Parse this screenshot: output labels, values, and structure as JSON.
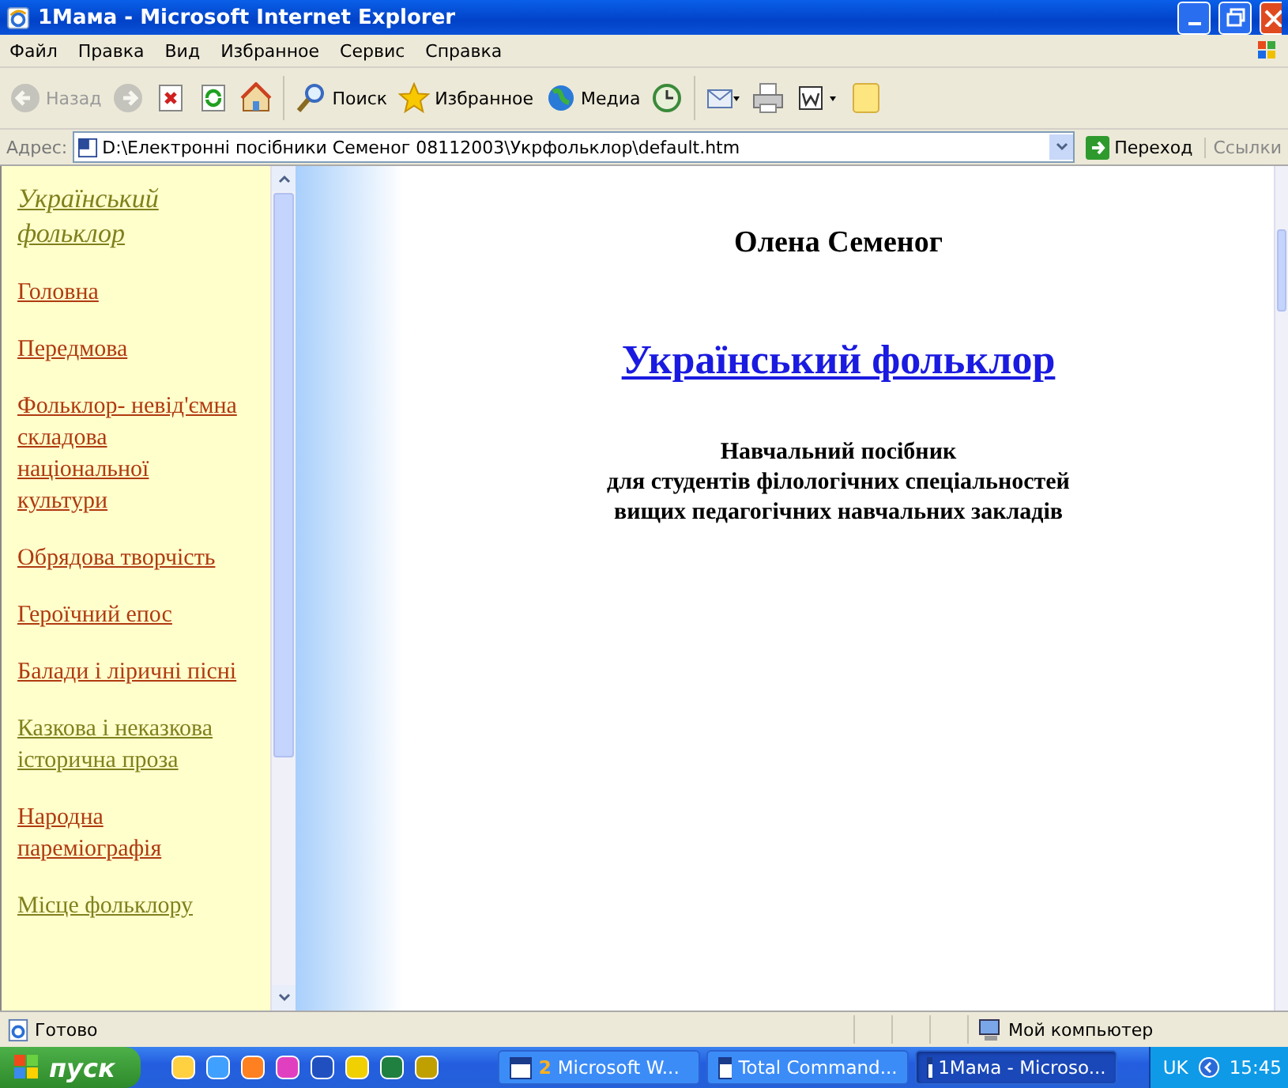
{
  "window": {
    "title": "1Мама - Microsoft Internet Explorer"
  },
  "menu": [
    "Файл",
    "Правка",
    "Вид",
    "Избранное",
    "Сервис",
    "Справка"
  ],
  "toolbar": [
    {
      "kind": "back",
      "label": "Назад",
      "disabled": true
    },
    {
      "kind": "forward",
      "disabled": true
    },
    {
      "kind": "stop",
      "disabled": false
    },
    {
      "kind": "refresh",
      "disabled": false
    },
    {
      "kind": "home",
      "disabled": false
    },
    {
      "kind": "search",
      "label": "Поиск",
      "disabled": false
    },
    {
      "kind": "favorites",
      "label": "Избранное",
      "disabled": false
    },
    {
      "kind": "media",
      "label": "Медиа",
      "disabled": false
    },
    {
      "kind": "history",
      "disabled": false
    },
    {
      "kind": "mail",
      "disabled": false
    },
    {
      "kind": "print",
      "disabled": false
    },
    {
      "kind": "edit",
      "disabled": false
    },
    {
      "kind": "note",
      "disabled": false
    }
  ],
  "address": {
    "label": "Адрес:",
    "value": "D:\\Електронні посібники Семеног 08112003\\Укрфольклор\\default.htm",
    "go": "Переход",
    "links": "Ссылки"
  },
  "sidebar": {
    "title": {
      "text": "Український фольклор",
      "visited": true
    },
    "links": [
      {
        "text": "Головна",
        "visited": false
      },
      {
        "text": "Передмова",
        "visited": false
      },
      {
        "text": "Фольклор- невід'ємна складова національної культури",
        "visited": false
      },
      {
        "text": "Обрядова творчість",
        "visited": false
      },
      {
        "text": "Героїчний епос",
        "visited": false
      },
      {
        "text": "Балади і ліричні пісні",
        "visited": false
      },
      {
        "text": "Казкова і неказкова історична проза",
        "visited": true
      },
      {
        "text": "Народна пареміографія",
        "visited": false
      },
      {
        "text": "Місце фольклору",
        "visited": true
      }
    ]
  },
  "page": {
    "author": "Олена Семеног",
    "title": "Український фольклор",
    "subtitle": [
      "Навчальний посібник",
      "для студентів філологічних спеціальностей",
      "вищих педагогічних навчальних закладів"
    ]
  },
  "status": {
    "text": "Готово",
    "zone": "Мой компьютер"
  },
  "taskbar": {
    "start": "пуск",
    "tasks": [
      {
        "count": "2",
        "label": "Microsoft W...",
        "selected": false
      },
      {
        "label": "Total Command...",
        "selected": false
      },
      {
        "label": "1Мама - Microso...",
        "selected": true
      }
    ],
    "lang": "UK",
    "clock": "15:45"
  }
}
